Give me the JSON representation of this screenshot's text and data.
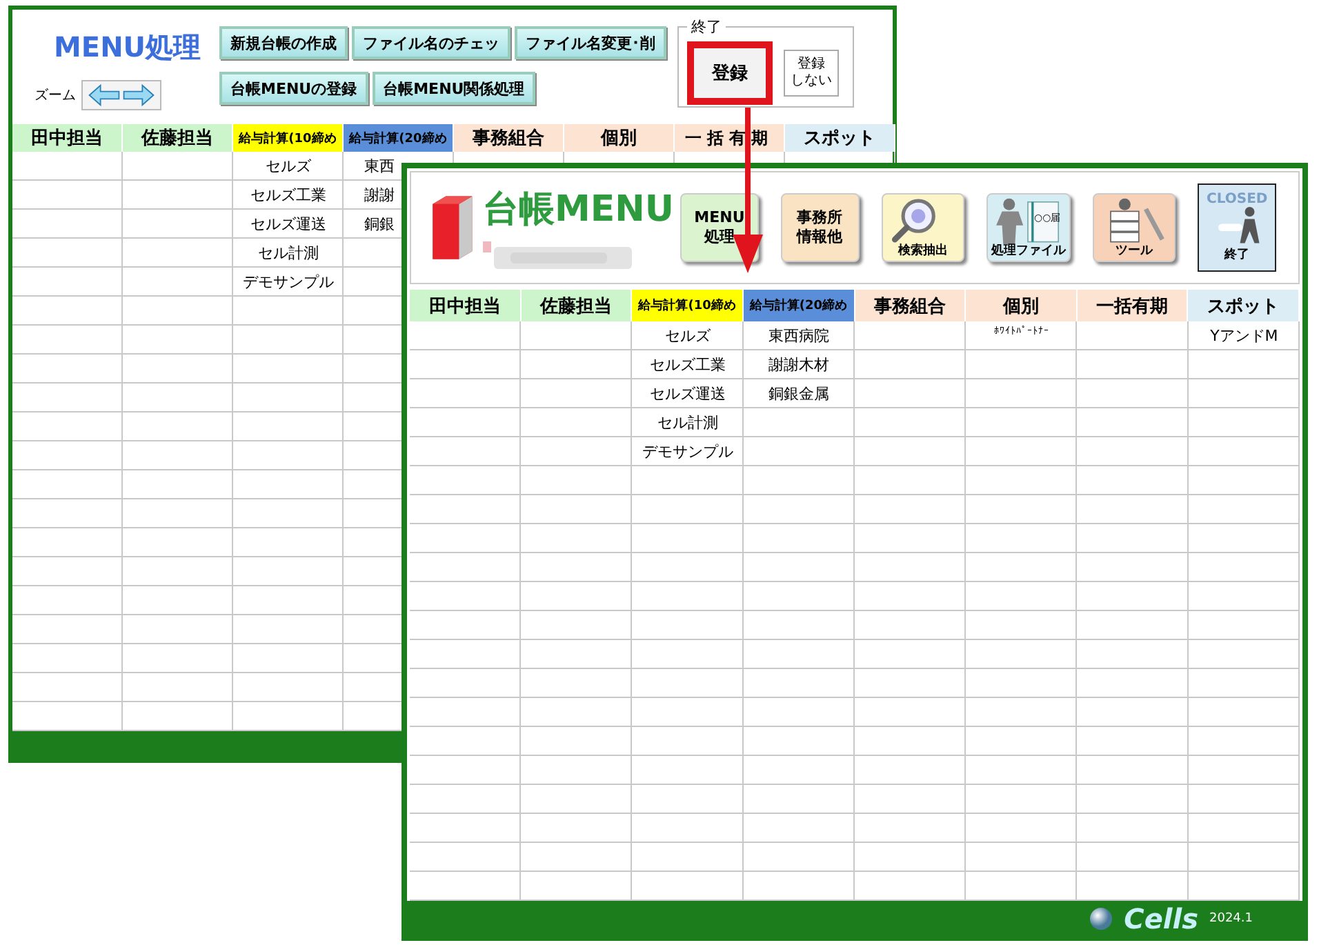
{
  "back_window": {
    "title": "MENU処理",
    "zoom_label": "ズーム",
    "button_rows": [
      [
        "新規台帳の作成",
        "ファイル名のチェッ",
        "ファイル名変更･削"
      ],
      [
        "台帳MENUの登録",
        "台帳MENU関係処理"
      ]
    ],
    "exit_group": {
      "label": "終了",
      "buttons": [
        {
          "lines": [
            "登録"
          ],
          "highlighted": true
        },
        {
          "lines": [
            "登録",
            "しない"
          ],
          "highlighted": false
        }
      ]
    },
    "table": {
      "columns": [
        {
          "label": "田中担当",
          "color": "#ccf5cc"
        },
        {
          "label": "佐藤担当",
          "color": "#ccf5cc"
        },
        {
          "label": "給与計算(10締め",
          "color": "#ffff00",
          "cells": [
            "セルズ",
            "セルズ工業",
            "セルズ運送",
            "セル計測",
            "デモサンプル"
          ]
        },
        {
          "label": "給与計算(20締め",
          "color": "#5b8ed8",
          "cells": [
            "東西",
            "謝謝",
            "銅銀"
          ]
        },
        {
          "label": "事務組合",
          "color": "#fde3d2"
        },
        {
          "label": "個別",
          "color": "#fde3d2"
        },
        {
          "label": "一括有期",
          "color": "#fde3d2"
        },
        {
          "label": "スポット",
          "color": "#dcedf6"
        }
      ]
    }
  },
  "front_window": {
    "title": "台帳MENU",
    "buttons": [
      {
        "kind": "text",
        "lines": [
          "MENU",
          "処理"
        ],
        "color": "#dcf3cf"
      },
      {
        "kind": "text",
        "lines": [
          "事務所",
          "情報他"
        ],
        "color": "#f9e3c3"
      },
      {
        "kind": "search",
        "lines": [
          "検索抽出"
        ],
        "color": "#fbf5c8"
      },
      {
        "kind": "files",
        "lines": [
          "処理ファイル"
        ],
        "icon_text": "○○届",
        "color": "#d5edf3"
      },
      {
        "kind": "tools",
        "lines": [
          "ツール"
        ],
        "color": "#f8d2b8"
      },
      {
        "kind": "closed",
        "badge": "CLOSED",
        "lines": [
          "終了"
        ],
        "color": "#d6e8f4"
      }
    ],
    "table": {
      "columns": [
        {
          "label": "田中担当",
          "color": "#ccf5cc"
        },
        {
          "label": "佐藤担当",
          "color": "#ccf5cc"
        },
        {
          "label": "給与計算(10締め",
          "color": "#ffff00",
          "cells": [
            "セルズ",
            "セルズ工業",
            "セルズ運送",
            "セル計測",
            "デモサンプル"
          ]
        },
        {
          "label": "給与計算(20締め",
          "color": "#5b8ed8",
          "cells": [
            "東西病院",
            "謝謝木材",
            "銅銀金属"
          ]
        },
        {
          "label": "事務組合",
          "color": "#fde3d2"
        },
        {
          "label": "個別",
          "color": "#fde3d2",
          "cells": [
            "ﾎﾜｲﾄﾊﾟｰﾄﾅｰ"
          ]
        },
        {
          "label": "一括有期",
          "color": "#fde3d2"
        },
        {
          "label": "スポット",
          "color": "#dcedf6",
          "cells": [
            "YアンドM"
          ]
        }
      ]
    },
    "footer": {
      "brand": "Cells",
      "version": "2024.1"
    }
  }
}
